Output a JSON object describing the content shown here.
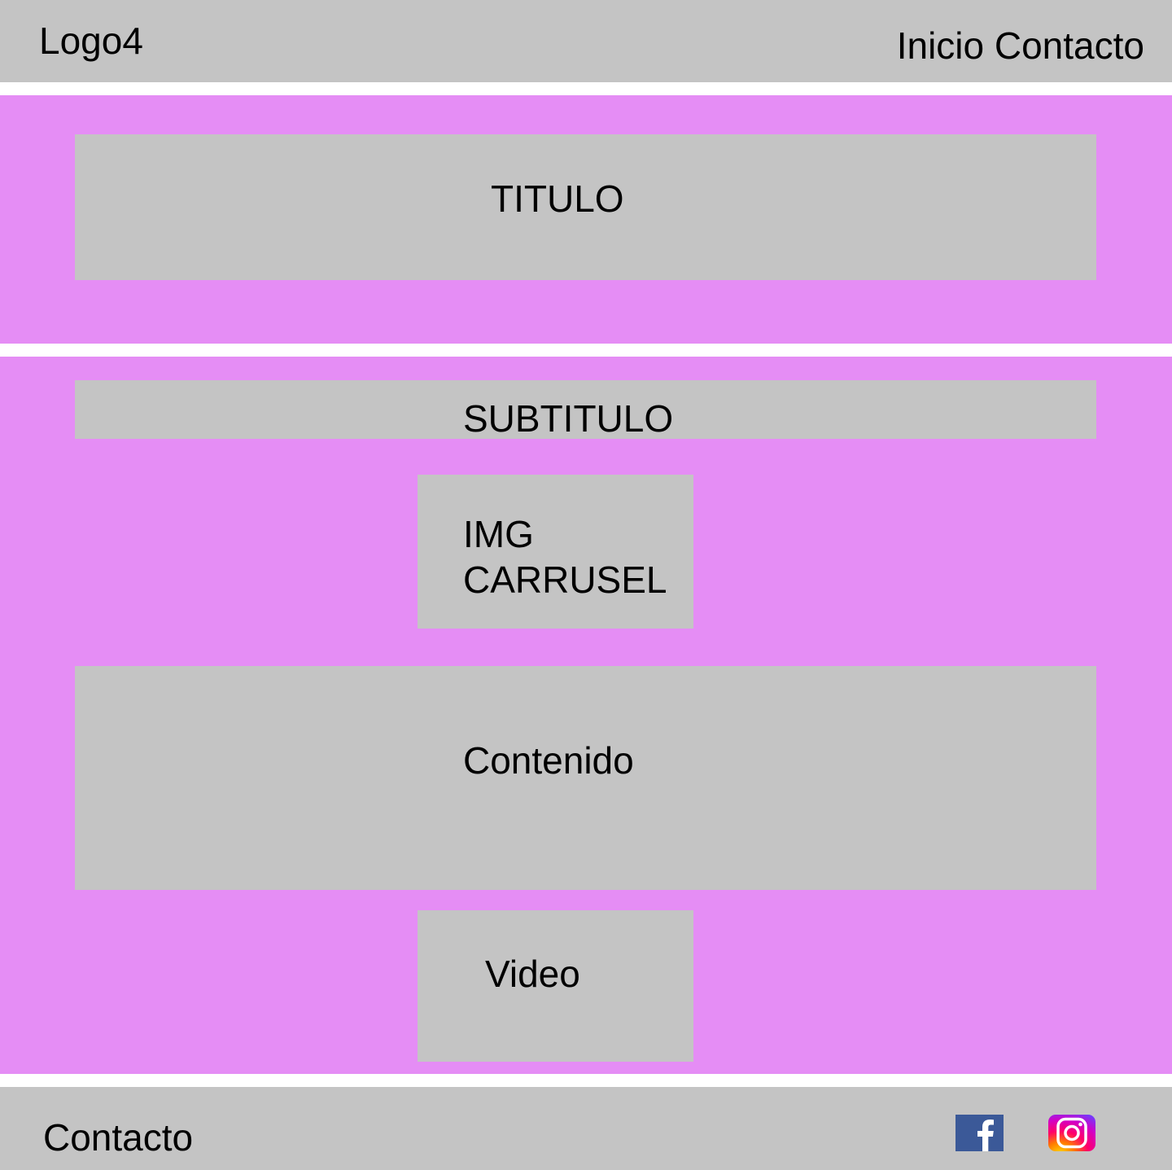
{
  "header": {
    "logo": "Logo4",
    "nav": [
      "Inicio",
      "Contacto"
    ]
  },
  "hero": {
    "title": "TITULO"
  },
  "main": {
    "subtitle": "SUBTITULO",
    "carousel_label": "IMG CARRUSEL",
    "content_label": "Contenido",
    "video_label": "Video"
  },
  "footer": {
    "contact": "Contacto",
    "icons": [
      "facebook-icon",
      "instagram-icon"
    ]
  },
  "colors": {
    "block_grey": "#c4c4c4",
    "section_pink": "#e58df5",
    "facebook_blue": "#3b5998"
  }
}
